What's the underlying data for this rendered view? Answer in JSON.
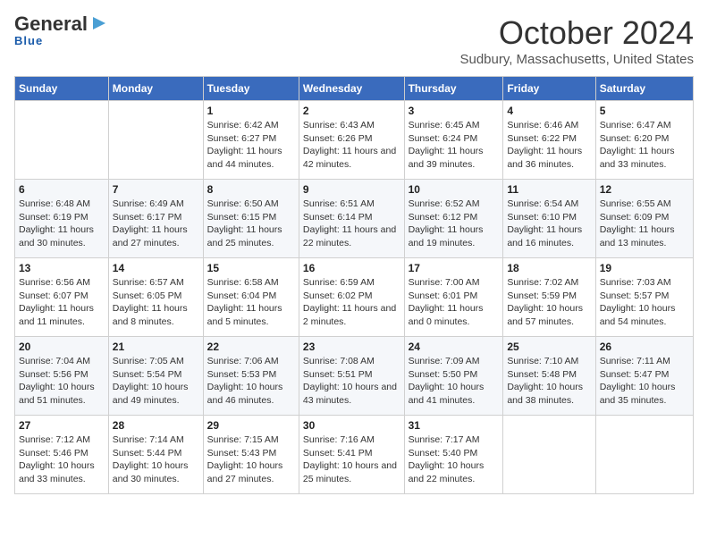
{
  "logo": {
    "general": "General",
    "blue": "Blue",
    "arrow": "▶"
  },
  "header": {
    "title": "October 2024",
    "subtitle": "Sudbury, Massachusetts, United States"
  },
  "calendar": {
    "weekdays": [
      "Sunday",
      "Monday",
      "Tuesday",
      "Wednesday",
      "Thursday",
      "Friday",
      "Saturday"
    ],
    "weeks": [
      [
        {
          "day": "",
          "info": ""
        },
        {
          "day": "",
          "info": ""
        },
        {
          "day": "1",
          "info": "Sunrise: 6:42 AM\nSunset: 6:27 PM\nDaylight: 11 hours and 44 minutes."
        },
        {
          "day": "2",
          "info": "Sunrise: 6:43 AM\nSunset: 6:26 PM\nDaylight: 11 hours and 42 minutes."
        },
        {
          "day": "3",
          "info": "Sunrise: 6:45 AM\nSunset: 6:24 PM\nDaylight: 11 hours and 39 minutes."
        },
        {
          "day": "4",
          "info": "Sunrise: 6:46 AM\nSunset: 6:22 PM\nDaylight: 11 hours and 36 minutes."
        },
        {
          "day": "5",
          "info": "Sunrise: 6:47 AM\nSunset: 6:20 PM\nDaylight: 11 hours and 33 minutes."
        }
      ],
      [
        {
          "day": "6",
          "info": "Sunrise: 6:48 AM\nSunset: 6:19 PM\nDaylight: 11 hours and 30 minutes."
        },
        {
          "day": "7",
          "info": "Sunrise: 6:49 AM\nSunset: 6:17 PM\nDaylight: 11 hours and 27 minutes."
        },
        {
          "day": "8",
          "info": "Sunrise: 6:50 AM\nSunset: 6:15 PM\nDaylight: 11 hours and 25 minutes."
        },
        {
          "day": "9",
          "info": "Sunrise: 6:51 AM\nSunset: 6:14 PM\nDaylight: 11 hours and 22 minutes."
        },
        {
          "day": "10",
          "info": "Sunrise: 6:52 AM\nSunset: 6:12 PM\nDaylight: 11 hours and 19 minutes."
        },
        {
          "day": "11",
          "info": "Sunrise: 6:54 AM\nSunset: 6:10 PM\nDaylight: 11 hours and 16 minutes."
        },
        {
          "day": "12",
          "info": "Sunrise: 6:55 AM\nSunset: 6:09 PM\nDaylight: 11 hours and 13 minutes."
        }
      ],
      [
        {
          "day": "13",
          "info": "Sunrise: 6:56 AM\nSunset: 6:07 PM\nDaylight: 11 hours and 11 minutes."
        },
        {
          "day": "14",
          "info": "Sunrise: 6:57 AM\nSunset: 6:05 PM\nDaylight: 11 hours and 8 minutes."
        },
        {
          "day": "15",
          "info": "Sunrise: 6:58 AM\nSunset: 6:04 PM\nDaylight: 11 hours and 5 minutes."
        },
        {
          "day": "16",
          "info": "Sunrise: 6:59 AM\nSunset: 6:02 PM\nDaylight: 11 hours and 2 minutes."
        },
        {
          "day": "17",
          "info": "Sunrise: 7:00 AM\nSunset: 6:01 PM\nDaylight: 11 hours and 0 minutes."
        },
        {
          "day": "18",
          "info": "Sunrise: 7:02 AM\nSunset: 5:59 PM\nDaylight: 10 hours and 57 minutes."
        },
        {
          "day": "19",
          "info": "Sunrise: 7:03 AM\nSunset: 5:57 PM\nDaylight: 10 hours and 54 minutes."
        }
      ],
      [
        {
          "day": "20",
          "info": "Sunrise: 7:04 AM\nSunset: 5:56 PM\nDaylight: 10 hours and 51 minutes."
        },
        {
          "day": "21",
          "info": "Sunrise: 7:05 AM\nSunset: 5:54 PM\nDaylight: 10 hours and 49 minutes."
        },
        {
          "day": "22",
          "info": "Sunrise: 7:06 AM\nSunset: 5:53 PM\nDaylight: 10 hours and 46 minutes."
        },
        {
          "day": "23",
          "info": "Sunrise: 7:08 AM\nSunset: 5:51 PM\nDaylight: 10 hours and 43 minutes."
        },
        {
          "day": "24",
          "info": "Sunrise: 7:09 AM\nSunset: 5:50 PM\nDaylight: 10 hours and 41 minutes."
        },
        {
          "day": "25",
          "info": "Sunrise: 7:10 AM\nSunset: 5:48 PM\nDaylight: 10 hours and 38 minutes."
        },
        {
          "day": "26",
          "info": "Sunrise: 7:11 AM\nSunset: 5:47 PM\nDaylight: 10 hours and 35 minutes."
        }
      ],
      [
        {
          "day": "27",
          "info": "Sunrise: 7:12 AM\nSunset: 5:46 PM\nDaylight: 10 hours and 33 minutes."
        },
        {
          "day": "28",
          "info": "Sunrise: 7:14 AM\nSunset: 5:44 PM\nDaylight: 10 hours and 30 minutes."
        },
        {
          "day": "29",
          "info": "Sunrise: 7:15 AM\nSunset: 5:43 PM\nDaylight: 10 hours and 27 minutes."
        },
        {
          "day": "30",
          "info": "Sunrise: 7:16 AM\nSunset: 5:41 PM\nDaylight: 10 hours and 25 minutes."
        },
        {
          "day": "31",
          "info": "Sunrise: 7:17 AM\nSunset: 5:40 PM\nDaylight: 10 hours and 22 minutes."
        },
        {
          "day": "",
          "info": ""
        },
        {
          "day": "",
          "info": ""
        }
      ]
    ]
  }
}
